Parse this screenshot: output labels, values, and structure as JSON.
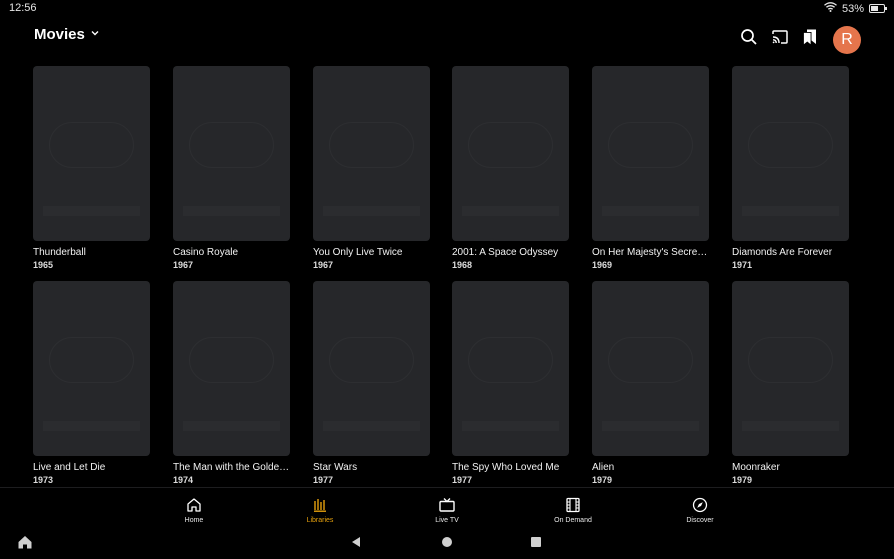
{
  "status_bar": {
    "time": "12:56",
    "battery": "53%",
    "battery_level": 0.53
  },
  "header": {
    "library_title": "Movies",
    "icons": [
      "search-icon",
      "cast-icon",
      "bookmark-icon"
    ],
    "avatar_initial": "R",
    "avatar_color": "#e5754c"
  },
  "movies": [
    {
      "title": "Thunderball",
      "year": "1965"
    },
    {
      "title": "Casino Royale",
      "year": "1967"
    },
    {
      "title": "You Only Live Twice",
      "year": "1967"
    },
    {
      "title": "2001: A Space Odyssey",
      "year": "1968"
    },
    {
      "title": "On Her Majesty's Secret Service",
      "year": "1969"
    },
    {
      "title": "Diamonds Are Forever",
      "year": "1971"
    },
    {
      "title": "Live and Let Die",
      "year": "1973"
    },
    {
      "title": "The Man with the Golden Gun",
      "year": "1974"
    },
    {
      "title": "Star Wars",
      "year": "1977"
    },
    {
      "title": "The Spy Who Loved Me",
      "year": "1977"
    },
    {
      "title": "Alien",
      "year": "1979"
    },
    {
      "title": "Moonraker",
      "year": "1979"
    }
  ],
  "bottom_nav": {
    "items": [
      {
        "label": "Home",
        "icon": "home-icon"
      },
      {
        "label": "Libraries",
        "icon": "libraries-icon"
      },
      {
        "label": "Live TV",
        "icon": "tv-icon"
      },
      {
        "label": "On Demand",
        "icon": "film-icon"
      },
      {
        "label": "Discover",
        "icon": "compass-icon"
      }
    ],
    "active_label": "Libraries",
    "accent_color": "#e5a00d"
  },
  "system_bar": {
    "icons": [
      "launcher-home-icon",
      "back-icon",
      "home-circle-icon",
      "recents-icon"
    ]
  }
}
